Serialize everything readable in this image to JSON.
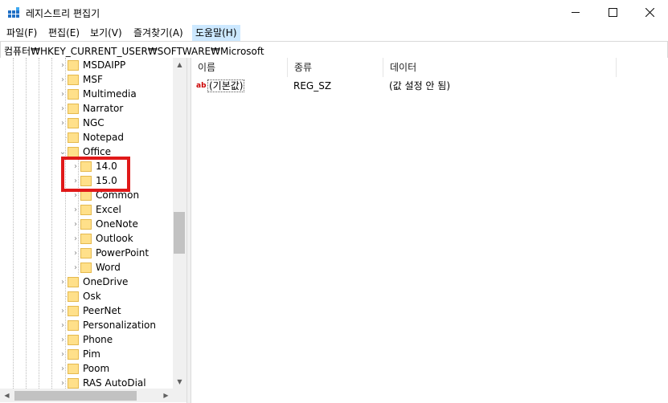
{
  "window": {
    "title": "레지스트리 편집기"
  },
  "menu": [
    "파일(F)",
    "편집(E)",
    "보기(V)",
    "즐겨찾기(A)",
    "도움말(H)"
  ],
  "address": "컴퓨터₩HKEY_CURRENT_USER₩SOFTWARE₩Microsoft",
  "tree": {
    "items": [
      {
        "label": "MSDAIPP",
        "expander": "›"
      },
      {
        "label": "MSF",
        "expander": "›"
      },
      {
        "label": "Multimedia",
        "expander": "›"
      },
      {
        "label": "Narrator",
        "expander": "›"
      },
      {
        "label": "NGC",
        "expander": "›"
      },
      {
        "label": "Notepad",
        "expander": ""
      },
      {
        "label": "Office",
        "expander": "⌄"
      },
      {
        "label": "14.0",
        "expander": "›"
      },
      {
        "label": "15.0",
        "expander": "›"
      },
      {
        "label": "Common",
        "expander": "›"
      },
      {
        "label": "Excel",
        "expander": "›"
      },
      {
        "label": "OneNote",
        "expander": "›"
      },
      {
        "label": "Outlook",
        "expander": "›"
      },
      {
        "label": "PowerPoint",
        "expander": "›"
      },
      {
        "label": "Word",
        "expander": "›"
      },
      {
        "label": "OneDrive",
        "expander": "›"
      },
      {
        "label": "Osk",
        "expander": ""
      },
      {
        "label": "PeerNet",
        "expander": "›"
      },
      {
        "label": "Personalization",
        "expander": "›"
      },
      {
        "label": "Phone",
        "expander": "›"
      },
      {
        "label": "Pim",
        "expander": "›"
      },
      {
        "label": "Poom",
        "expander": "›"
      },
      {
        "label": "RAS AutoDial",
        "expander": "›"
      }
    ]
  },
  "list": {
    "columns": [
      "이름",
      "종류",
      "데이터"
    ],
    "rows": [
      {
        "name": "(기본값)",
        "type": "REG_SZ",
        "data": "(값 설정 안 됨)",
        "icon": "ab"
      }
    ]
  }
}
